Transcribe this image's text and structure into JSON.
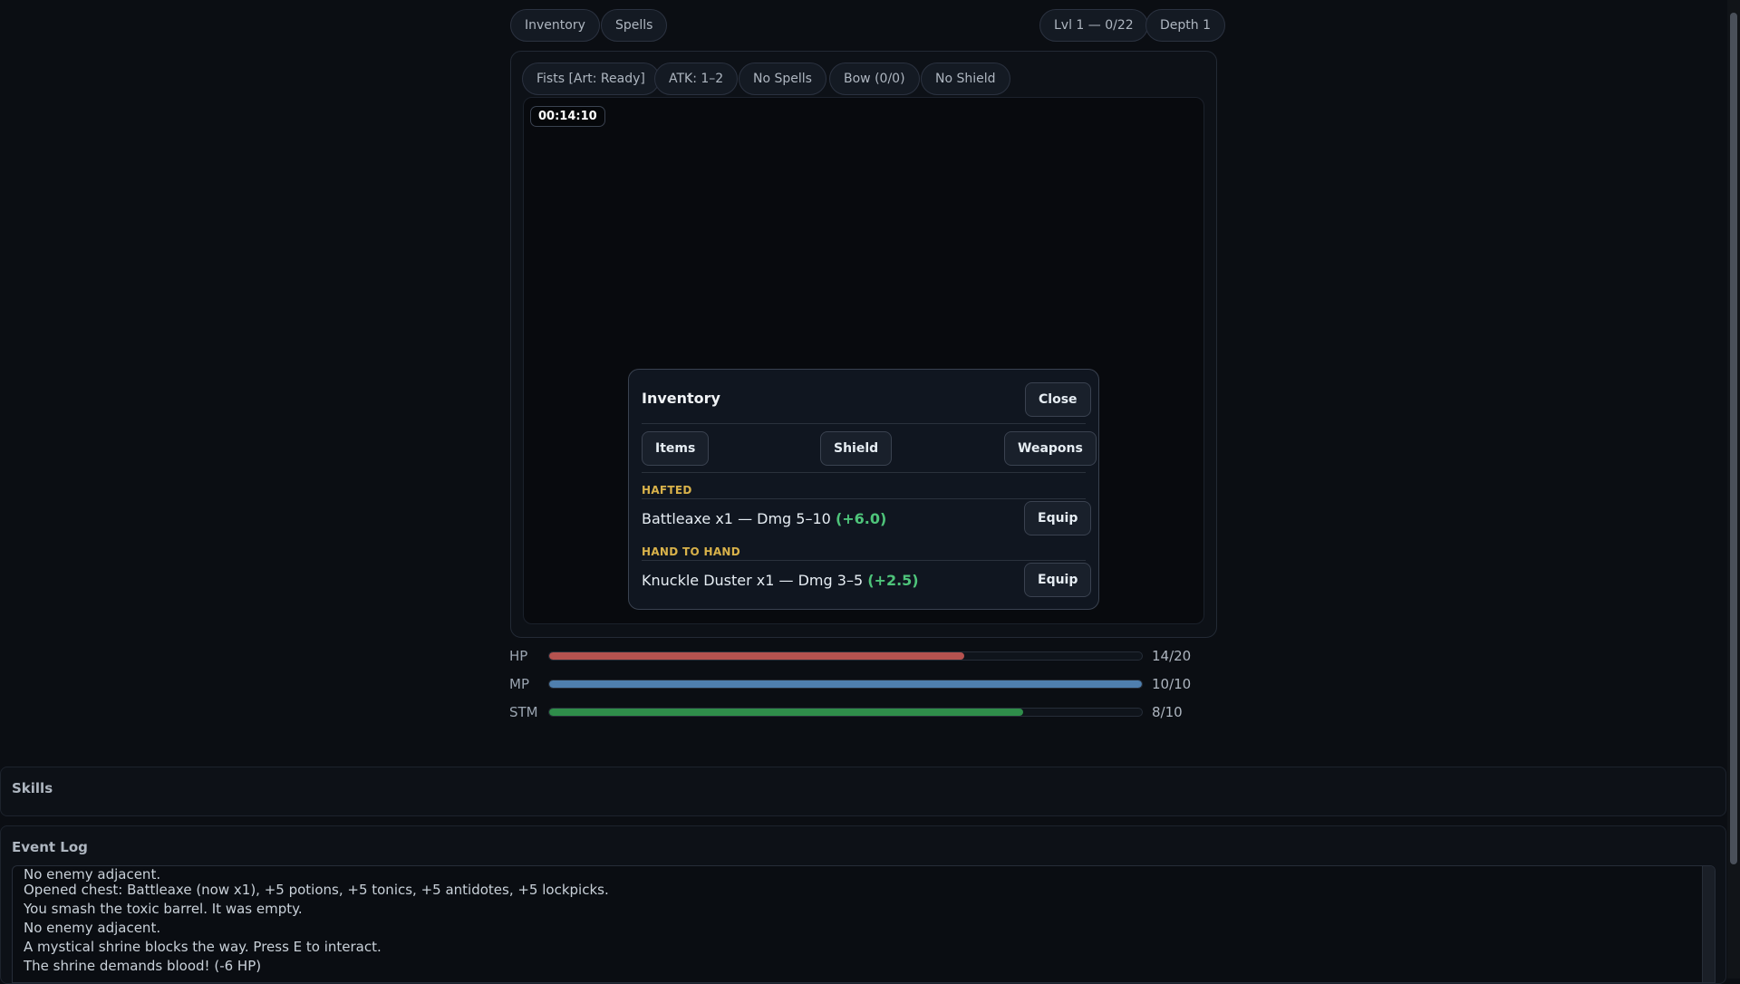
{
  "topbar": {
    "inventory": "Inventory",
    "spells": "Spells",
    "level": "Lvl 1 — 0/22",
    "depth": "Depth 1"
  },
  "status": {
    "weapon": "Fists [Art: Ready]",
    "attack": "ATK: 1–2",
    "spells": "No Spells",
    "bow": "Bow (0/0)",
    "shield": "No Shield"
  },
  "timer": "00:14:10",
  "inventory_modal": {
    "title": "Inventory",
    "close_label": "Close",
    "tabs": [
      "Items",
      "Shield",
      "Weapons"
    ],
    "categories": [
      {
        "name": "HAFTED",
        "item": "Battleaxe x1 — Dmg 5–10",
        "bonus": "(+6.0)",
        "action": "Equip"
      },
      {
        "name": "HAND TO HAND",
        "item": "Knuckle Duster x1 — Dmg 3–5",
        "bonus": "(+2.5)",
        "action": "Equip"
      }
    ]
  },
  "stats": [
    {
      "label": "HP",
      "value": "14/20",
      "fraction": 0.7,
      "color": "#b5524f"
    },
    {
      "label": "MP",
      "value": "10/10",
      "fraction": 1.0,
      "color": "#4f7fae"
    },
    {
      "label": "STM",
      "value": "8/10",
      "fraction": 0.8,
      "color": "#2f8d4a"
    }
  ],
  "skills": {
    "title": "Skills"
  },
  "event_log": {
    "title": "Event Log",
    "lines": [
      "No enemy adjacent.",
      "Opened chest: Battleaxe (now x1), +5 potions, +5 tonics, +5 antidotes, +5 lockpicks.",
      "You smash the toxic barrel. It was empty.",
      "No enemy adjacent.",
      "A mystical shrine blocks the way. Press E to interact.",
      "The shrine demands blood! (-6 HP)"
    ]
  }
}
